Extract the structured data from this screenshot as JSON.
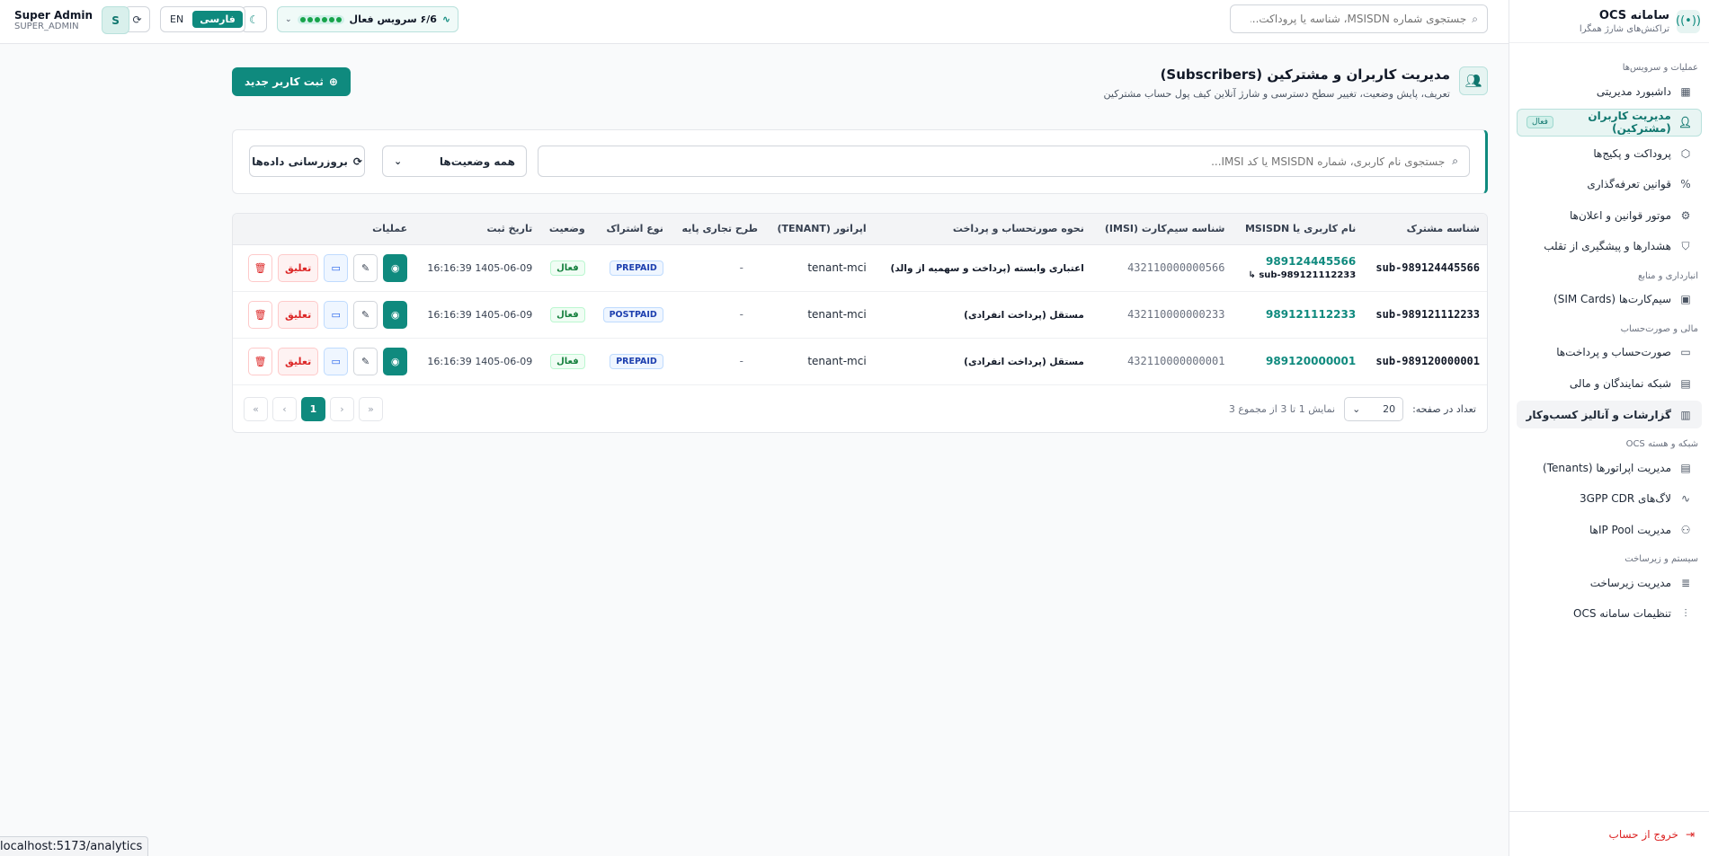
{
  "app": {
    "title": "سامانه OCS",
    "subtitle": "تراکنش‌های شارژ همگرا"
  },
  "sidebar": {
    "sections": [
      {
        "label": "عملیات و سرویس‌ها",
        "items": [
          {
            "label": "داشبورد مدیریتی",
            "icon": "dashboard-icon"
          },
          {
            "label": "مدیریت کاربران (مشترکین)",
            "icon": "users-icon",
            "active": true,
            "badge": "فعال"
          },
          {
            "label": "پروداکت و پکیج‌ها",
            "icon": "package-icon"
          },
          {
            "label": "قوانین تعرفه‌گذاری",
            "icon": "percent-icon"
          },
          {
            "label": "موتور قوانین و اعلان‌ها",
            "icon": "bell-icon"
          },
          {
            "label": "هشدارها و پیشگیری از تقلب",
            "icon": "shield-icon"
          }
        ]
      },
      {
        "label": "انبارداری و منابع",
        "items": [
          {
            "label": "سیم‌کارت‌ها (SIM Cards)",
            "icon": "sim-icon"
          }
        ]
      },
      {
        "label": "مالی و صورت‌حساب",
        "items": [
          {
            "label": "صورت‌حساب و پرداخت‌ها",
            "icon": "credit-card-icon"
          },
          {
            "label": "شبکه نمایندگان و مالی",
            "icon": "building-icon"
          },
          {
            "label": "گزارشات و آنالیز کسب‌وکار",
            "icon": "chart-icon",
            "hover": true
          }
        ]
      },
      {
        "label": "شبکه و هسته OCS",
        "items": [
          {
            "label": "مدیریت اپراتورها (Tenants)",
            "icon": "building-icon"
          },
          {
            "label": "لاگ‌های 3GPP CDR",
            "icon": "activity-icon"
          },
          {
            "label": "مدیریت IP Poolها",
            "icon": "network-icon"
          }
        ]
      },
      {
        "label": "سیستم و زیرساخت",
        "items": [
          {
            "label": "مدیریت زیرساخت",
            "icon": "database-icon"
          },
          {
            "label": "تنظیمات سامانه OCS",
            "icon": "sliders-icon"
          }
        ]
      }
    ],
    "logout": "خروج از حساب"
  },
  "topbar": {
    "search_placeholder": "جستجوی شماره MSISDN، شناسه یا پروداکت...",
    "services": "۶/6 سرویس فعال",
    "lang_fa": "فارسی",
    "lang_en": "EN",
    "user_name": "Super Admin",
    "user_role": "SUPER_ADMIN",
    "avatar": "S"
  },
  "page": {
    "title": "مدیریت کاربران و مشترکین (Subscribers)",
    "subtitle": "تعریف، پایش وضعیت، تغییر سطح دسترسی و شارژ آنلاین کیف پول حساب مشترکین",
    "new_button": "ثبت کاربر جدید"
  },
  "filters": {
    "search_placeholder": "جستجوی نام کاربری، شماره MSISDN یا کد IMSI...",
    "status_selected": "همه وضعیت‌ها",
    "refresh": "بروزرسانی داده‌ها"
  },
  "table": {
    "columns": [
      "شناسه مشترک",
      "نام کاربری یا MSISDN",
      "شناسه سیم‌کارت (IMSI)",
      "نحوه صورتحساب و پرداخت",
      "اپراتور (TENANT)",
      "طرح تجاری پایه",
      "نوع اشتراک",
      "وضعیت",
      "تاریخ ثبت",
      "عملیات"
    ],
    "rows": [
      {
        "id": "sub-989124445566",
        "msisdn": "989124445566",
        "parent": "↳ sub-989121112233",
        "imsi": "432110000000566",
        "billing": "اعتباری وابسته (پرداخت و سهمیه از والد)",
        "tenant": "tenant-mci",
        "plan": "-",
        "type": "PREPAID",
        "status": "فعال",
        "date": "1405-06-09 16:16:39"
      },
      {
        "id": "sub-989121112233",
        "msisdn": "989121112233",
        "parent": "",
        "imsi": "432110000000233",
        "billing": "مستقل (پرداخت انفرادی)",
        "tenant": "tenant-mci",
        "plan": "-",
        "type": "POSTPAID",
        "status": "فعال",
        "date": "1405-06-09 16:16:39"
      },
      {
        "id": "sub-989120000001",
        "msisdn": "989120000001",
        "parent": "",
        "imsi": "432110000000001",
        "billing": "مستقل (پرداخت انفرادی)",
        "tenant": "tenant-mci",
        "plan": "-",
        "type": "PREPAID",
        "status": "فعال",
        "date": "1405-06-09 16:16:39"
      }
    ],
    "suspend_label": "تعلیق"
  },
  "pager": {
    "per_page_label": "تعداد در صفحه:",
    "per_page": "20",
    "summary": "نمایش 1 تا 3 از مجموع 3",
    "current": "1"
  },
  "statusbar": "localhost:5173/analytics"
}
